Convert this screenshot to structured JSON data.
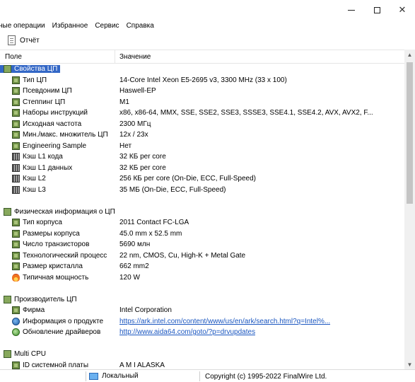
{
  "window": {
    "minimize_glyph": "",
    "maximize_glyph": "",
    "close_glyph": "✕"
  },
  "menu": [
    "ные операции",
    "Избранное",
    "Сервис",
    "Справка"
  ],
  "toolbar": {
    "report_label": "Отчёт"
  },
  "columns": {
    "field": "Поле",
    "value": "Значение"
  },
  "sections": [
    {
      "title": "Свойства ЦП",
      "icon": "cpu-section-icon",
      "selected": true,
      "rows": [
        {
          "icon": "cpu-icon",
          "field": "Тип ЦП",
          "value": "14-Core Intel Xeon E5-2695 v3, 3300 MHz (33 x 100)"
        },
        {
          "icon": "cpu-icon",
          "field": "Псевдоним ЦП",
          "value": "Haswell-EP"
        },
        {
          "icon": "cpu-icon",
          "field": "Степпинг ЦП",
          "value": "M1"
        },
        {
          "icon": "cpu-icon",
          "field": "Наборы инструкций",
          "value": "x86, x86-64, MMX, SSE, SSE2, SSE3, SSSE3, SSE4.1, SSE4.2, AVX, AVX2, F..."
        },
        {
          "icon": "cpu-icon",
          "field": "Исходная частота",
          "value": "2300 МГц"
        },
        {
          "icon": "cpu-icon",
          "field": "Мин./макс. множитель ЦП",
          "value": "12x / 23x"
        },
        {
          "icon": "cpu-icon",
          "field": "Engineering Sample",
          "value": "Нет"
        },
        {
          "icon": "memory-icon",
          "field": "Кэш L1 кода",
          "value": "32 КБ per core"
        },
        {
          "icon": "memory-icon",
          "field": "Кэш L1 данных",
          "value": "32 КБ per core"
        },
        {
          "icon": "memory-icon",
          "field": "Кэш L2",
          "value": "256 КБ per core  (On-Die, ECC, Full-Speed)"
        },
        {
          "icon": "memory-icon",
          "field": "Кэш L3",
          "value": "35 МБ  (On-Die, ECC, Full-Speed)"
        }
      ]
    },
    {
      "title": "Физическая информация о ЦП",
      "icon": "cpu-section-icon",
      "selected": false,
      "rows": [
        {
          "icon": "cpu-icon",
          "field": "Тип корпуса",
          "value": "2011 Contact FC-LGA"
        },
        {
          "icon": "cpu-icon",
          "field": "Размеры корпуса",
          "value": "45.0 mm x 52.5 mm"
        },
        {
          "icon": "cpu-icon",
          "field": "Число транзисторов",
          "value": "5690 млн"
        },
        {
          "icon": "cpu-icon",
          "field": "Технологический процесс",
          "value": "22 nm, CMOS, Cu, High-K + Metal Gate"
        },
        {
          "icon": "cpu-icon",
          "field": "Размер кристалла",
          "value": "662 mm2"
        },
        {
          "icon": "fire-icon",
          "field": "Типичная мощность",
          "value": "120 W"
        }
      ]
    },
    {
      "title": "Производитель ЦП",
      "icon": "cpu-section-icon",
      "selected": false,
      "rows": [
        {
          "icon": "cpu-icon",
          "field": "Фирма",
          "value": "Intel Corporation"
        },
        {
          "icon": "link-icon",
          "field": "Информация о продукте",
          "value": "https://ark.intel.com/content/www/us/en/ark/search.html?q=Intel%...",
          "link": true
        },
        {
          "icon": "update-icon",
          "field": "Обновление драйверов",
          "value": "http://www.aida64.com/goto/?p=drvupdates",
          "link": true
        }
      ]
    },
    {
      "title": "Multi CPU",
      "icon": "cpu-section-icon",
      "selected": false,
      "rows": [
        {
          "icon": "cpu-icon",
          "field": "ID системной платы",
          "value": "A M I ALASKA"
        }
      ]
    }
  ],
  "status": {
    "local_label": "Локальный",
    "copyright": "Copyright (c) 1995-2022 FinalWire Ltd."
  }
}
